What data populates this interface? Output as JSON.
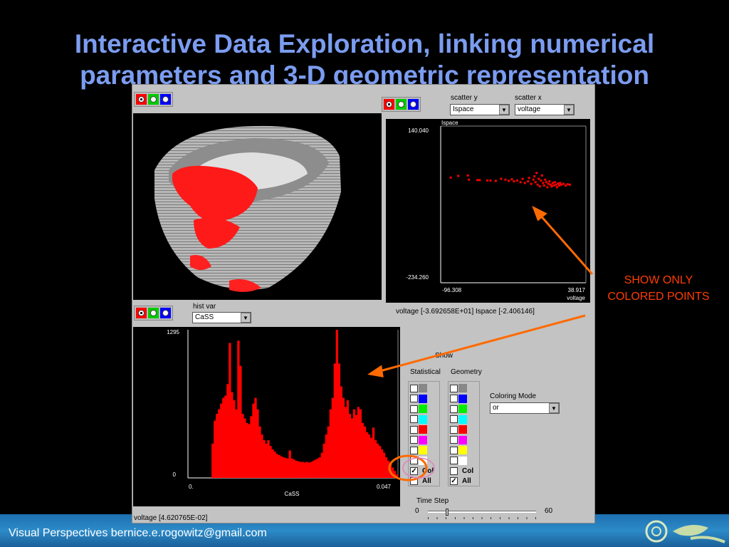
{
  "slide": {
    "title_line1": "Interactive Data Exploration, linking numerical",
    "title_line2": "parameters and 3-D geometric representation"
  },
  "annotation": {
    "line1": "SHOW ONLY",
    "line2": "COLORED POINTS",
    "color": "#ff3c00",
    "arrow_color": "#ff6a00"
  },
  "footer": {
    "text": "Visual Perspectives  bernice.e.rogowitz@gmail.com"
  },
  "scatter": {
    "y_label": "scatter y",
    "x_label": "scatter x",
    "y_value": "Ispace",
    "x_value": "voltage",
    "readout": "voltage  [-3.692658E+01]  Ispace  [-2.406146]"
  },
  "hist": {
    "var_label": "hist var",
    "var_value": "CaSS",
    "readout": "voltage  [4.620765E-02]"
  },
  "controls": {
    "show_label": "Show",
    "statistical_label": "Statistical",
    "geometry_label": "Geometry",
    "col_label": "Col",
    "all_label": "All",
    "stat_col_checked": true,
    "stat_all_checked": false,
    "geo_col_checked": false,
    "geo_all_checked": true,
    "swatches": [
      "#888888",
      "#0000ff",
      "#00ee00",
      "#00ffff",
      "#ff0000",
      "#ff00ff",
      "#ffff00",
      "#ffffff"
    ],
    "coloring_mode_label": "Coloring Mode",
    "coloring_mode_value": "or",
    "time_step_label": "Time Step",
    "time_min": "0",
    "time_max": "60",
    "time_value": 10
  },
  "chart_data": [
    {
      "type": "scatter",
      "title": "",
      "xlabel": "voltage",
      "ylabel": "Ispace",
      "xlim": [
        -96.308,
        38.917
      ],
      "ylim": [
        -234.26,
        140.04
      ],
      "x_min_label": "-96.308",
      "x_max_label": "38.917",
      "y_min_label": "-234.260",
      "y_max_label": "140.040",
      "color": "#ff0000",
      "points": [
        [
          -87,
          17
        ],
        [
          -80,
          21
        ],
        [
          -71,
          22
        ],
        [
          -70,
          12
        ],
        [
          -62,
          11
        ],
        [
          -60,
          11
        ],
        [
          -53,
          10
        ],
        [
          -50,
          10
        ],
        [
          -45,
          9
        ],
        [
          -40,
          14
        ],
        [
          -36,
          12
        ],
        [
          -33,
          9
        ],
        [
          -30,
          13
        ],
        [
          -28,
          8
        ],
        [
          -25,
          10
        ],
        [
          -22,
          6
        ],
        [
          -20,
          14
        ],
        [
          -18,
          4
        ],
        [
          -15,
          8
        ],
        [
          -14,
          16
        ],
        [
          -12,
          2
        ],
        [
          -10,
          12
        ],
        [
          -9,
          20
        ],
        [
          -8,
          6
        ],
        [
          -7,
          28
        ],
        [
          -6,
          0
        ],
        [
          -5,
          14
        ],
        [
          -4,
          -4
        ],
        [
          -3,
          10
        ],
        [
          -2,
          22
        ],
        [
          -1,
          4
        ],
        [
          0,
          -2
        ],
        [
          1,
          12
        ],
        [
          2,
          6
        ],
        [
          3,
          -6
        ],
        [
          4,
          2
        ],
        [
          5,
          8
        ],
        [
          6,
          0
        ],
        [
          7,
          -4
        ],
        [
          8,
          4
        ],
        [
          9,
          -2
        ],
        [
          10,
          6
        ],
        [
          11,
          0
        ],
        [
          12,
          -6
        ],
        [
          13,
          3
        ],
        [
          14,
          -2
        ],
        [
          15,
          4
        ],
        [
          16,
          0
        ],
        [
          18,
          2
        ],
        [
          20,
          -2
        ],
        [
          22,
          1
        ],
        [
          24,
          0
        ]
      ]
    },
    {
      "type": "bar",
      "title": "",
      "xlabel": "CaSS",
      "ylabel": "",
      "xlim": [
        0,
        0.047
      ],
      "ylim": [
        0,
        1295
      ],
      "x_min_label": "0.",
      "x_max_label": "0.047",
      "y_min_label": "0",
      "y_max_label": "1295",
      "color": "#ff0000",
      "values": [
        0,
        0,
        0,
        0,
        0,
        0,
        0,
        0,
        0,
        0,
        0,
        300,
        500,
        560,
        600,
        650,
        700,
        720,
        820,
        1180,
        750,
        680,
        600,
        1200,
        980,
        560,
        520,
        480,
        470,
        540,
        650,
        700,
        600,
        450,
        380,
        330,
        300,
        330,
        280,
        250,
        230,
        210,
        200,
        190,
        180,
        175,
        170,
        240,
        170,
        160,
        150,
        145,
        140,
        140,
        135,
        140,
        135,
        140,
        150,
        160,
        170,
        180,
        220,
        300,
        380,
        450,
        600,
        700,
        1000,
        1295,
        1000,
        800,
        700,
        620,
        680,
        560,
        520,
        600,
        550,
        620,
        600,
        480,
        450,
        400,
        380,
        350,
        440,
        330,
        300,
        280,
        250,
        220,
        180,
        150,
        120,
        90,
        60,
        30
      ]
    }
  ]
}
